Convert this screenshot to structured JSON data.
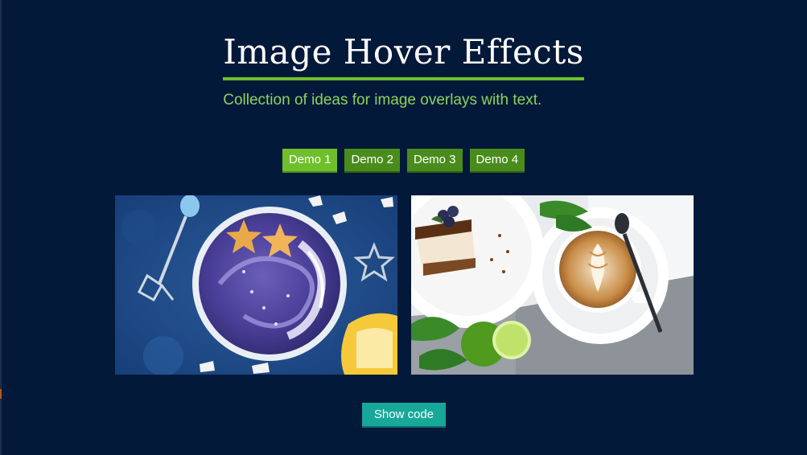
{
  "header": {
    "title": "Image Hover Effects",
    "subtitle": "Collection of ideas for image overlays with text."
  },
  "demos": {
    "items": [
      {
        "label": "Demo 1",
        "active": true
      },
      {
        "label": "Demo 2",
        "active": false
      },
      {
        "label": "Demo 3",
        "active": false
      },
      {
        "label": "Demo 4",
        "active": false
      }
    ]
  },
  "gallery": {
    "items": [
      {
        "subject": "smoothie-bowl-photo"
      },
      {
        "subject": "coffee-and-cake-photo"
      }
    ]
  },
  "footer": {
    "show_code_label": "Show code"
  },
  "colors": {
    "background": "#03193a",
    "accent_green": "#6fbf2b",
    "subtitle_green": "#8cd35e",
    "button_green": "#4a8c1c",
    "teal": "#17a89a"
  }
}
